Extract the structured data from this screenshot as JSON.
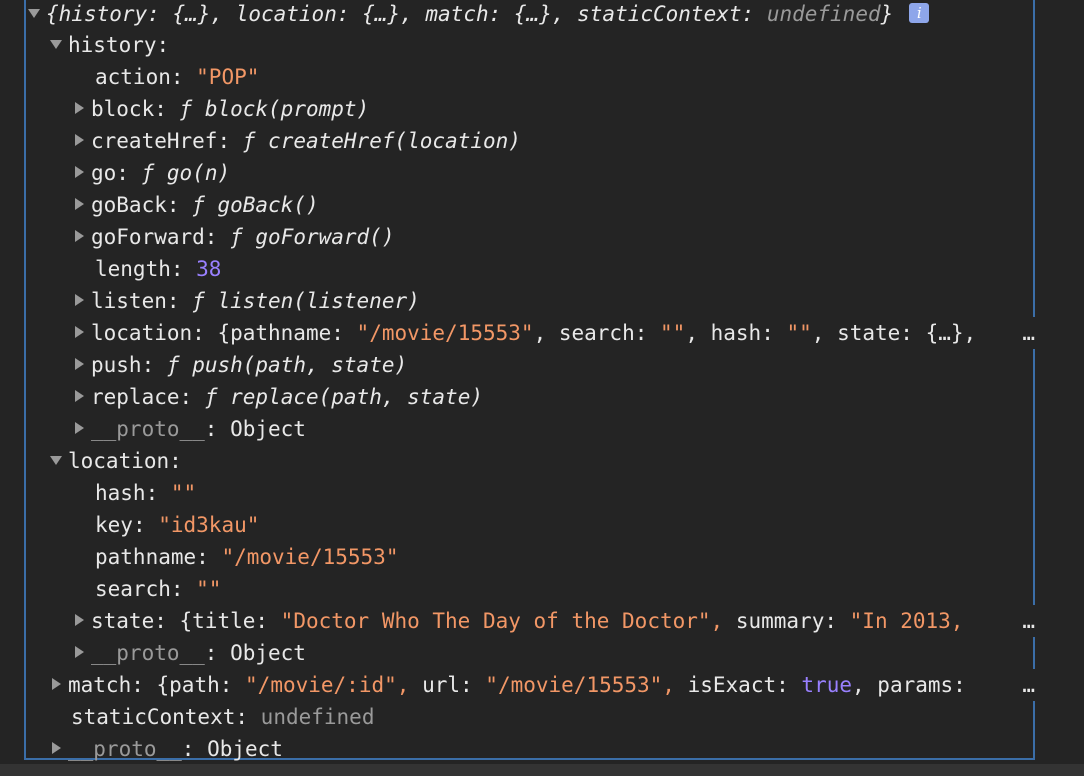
{
  "summary": {
    "open_brace": "{",
    "close_brace": "}",
    "parts": [
      {
        "key": "history",
        "value": "{…}"
      },
      {
        "key": "location",
        "value": "{…}"
      },
      {
        "key": "match",
        "value": "{…}"
      },
      {
        "key": "staticContext",
        "value": "undefined"
      }
    ],
    "info_badge": "i"
  },
  "history": {
    "label": "history",
    "props": {
      "action": {
        "key": "action",
        "value": "\"POP\""
      },
      "block": {
        "key": "block",
        "f": "ƒ",
        "sig": "block(prompt)"
      },
      "createHref": {
        "key": "createHref",
        "f": "ƒ",
        "sig": "createHref(location)"
      },
      "go": {
        "key": "go",
        "f": "ƒ",
        "sig": "go(n)"
      },
      "goBack": {
        "key": "goBack",
        "f": "ƒ",
        "sig": "goBack()"
      },
      "goForward": {
        "key": "goForward",
        "f": "ƒ",
        "sig": "goForward()"
      },
      "length": {
        "key": "length",
        "value": "38"
      },
      "listen": {
        "key": "listen",
        "f": "ƒ",
        "sig": "listen(listener)"
      },
      "location": {
        "key": "location",
        "pathname_key": "pathname",
        "pathname_val": "\"/movie/15553\"",
        "search_key": "search",
        "search_val": "\"\"",
        "hash_key": "hash",
        "hash_val": "\"\"",
        "state_key": "state",
        "state_val": "{…},",
        "ellipsis": "…"
      },
      "push": {
        "key": "push",
        "f": "ƒ",
        "sig": "push(path, state)"
      },
      "replace": {
        "key": "replace",
        "f": "ƒ",
        "sig": "replace(path, state)"
      },
      "proto": {
        "key": "__proto__",
        "value": "Object"
      }
    }
  },
  "location": {
    "label": "location",
    "props": {
      "hash": {
        "key": "hash",
        "value": "\"\""
      },
      "key": {
        "key": "key",
        "value": "\"id3kau\""
      },
      "pathname": {
        "key": "pathname",
        "value": "\"/movie/15553\""
      },
      "search": {
        "key": "search",
        "value": "\"\""
      },
      "state": {
        "key": "state",
        "title_key": "title",
        "title_val": "\"Doctor Who The Day of the Doctor\",",
        "summary_key": "summary",
        "summary_val": "\"In 2013,",
        "ellipsis": "…"
      },
      "proto": {
        "key": "__proto__",
        "value": "Object"
      }
    }
  },
  "match": {
    "key": "match",
    "path_key": "path",
    "path_val": "\"/movie/:id\",",
    "url_key": "url",
    "url_val": "\"/movie/15553\",",
    "isExact_key": "isExact",
    "isExact_val": "true",
    "params_key": "params",
    "ellipsis": "…"
  },
  "staticContext": {
    "key": "staticContext",
    "value": "undefined"
  },
  "root_proto": {
    "key": "__proto__",
    "value": "Object"
  },
  "colors": {
    "string": "#f29766",
    "number": "#9980ff",
    "keyword": "#9980ff",
    "dimmed": "#9a9a9a",
    "selection_border": "#3b6ea8"
  }
}
